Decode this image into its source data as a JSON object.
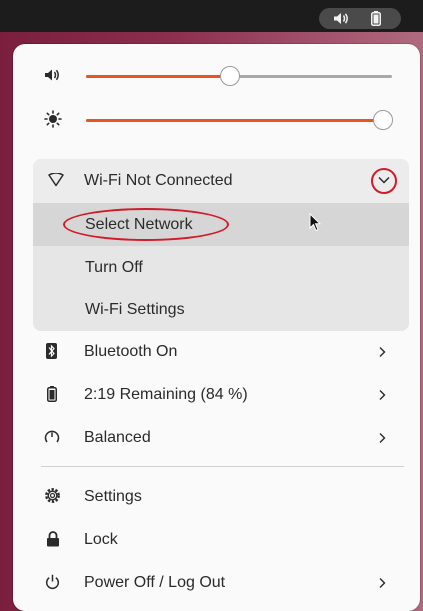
{
  "colors": {
    "accent": "#e95420",
    "annotation": "#d11a2a",
    "panel": "#fafafa"
  },
  "topbar": {
    "speaker_icon": "speaker-icon",
    "battery_icon": "battery-icon"
  },
  "sliders": {
    "volume": {
      "icon": "volume-icon",
      "level_percent": 47
    },
    "brightness": {
      "icon": "brightness-icon",
      "level_percent": 97
    }
  },
  "wifi": {
    "icon": "wifi-icon",
    "label": "Wi-Fi Not Connected",
    "expanded": true,
    "items": [
      {
        "label": "Select Network",
        "hovered": true
      },
      {
        "label": "Turn Off"
      },
      {
        "label": "Wi-Fi Settings"
      }
    ]
  },
  "rows": [
    {
      "icon": "bluetooth-icon",
      "label": "Bluetooth On",
      "has_submenu": true
    },
    {
      "icon": "battery-icon",
      "label": "2:19 Remaining (84 %)",
      "has_submenu": true
    },
    {
      "icon": "power-profile-icon",
      "label": "Balanced",
      "has_submenu": true
    }
  ],
  "bottom_rows": [
    {
      "icon": "gear-icon",
      "label": "Settings"
    },
    {
      "icon": "lock-icon",
      "label": "Lock"
    },
    {
      "icon": "power-icon",
      "label": "Power Off / Log Out",
      "has_submenu": true
    }
  ]
}
